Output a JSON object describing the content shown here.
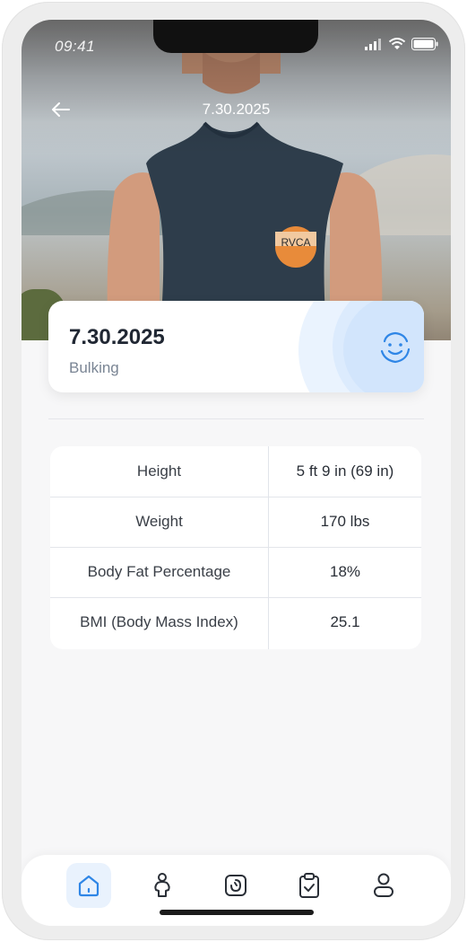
{
  "status_bar": {
    "time": "09:41"
  },
  "header": {
    "title": "7.30.2025"
  },
  "card": {
    "date": "7.30.2025",
    "phase": "Bulking"
  },
  "metrics": [
    {
      "label": "Height",
      "value": "5 ft 9 in (69 in)"
    },
    {
      "label": "Weight",
      "value": "170 lbs"
    },
    {
      "label": "Body Fat Percentage",
      "value": "18%"
    },
    {
      "label": "BMI (Body Mass Index)",
      "value": "25.1"
    }
  ],
  "shirt_logo": "RVCA",
  "nav": {
    "items": [
      "home-icon",
      "body-icon",
      "timer-icon",
      "checklist-icon",
      "profile-icon"
    ],
    "active": "home-icon"
  },
  "colors": {
    "accent": "#2f86e6",
    "active_bg": "#e9f2fd",
    "text_dark": "#202733",
    "text_muted": "#7a8594"
  }
}
